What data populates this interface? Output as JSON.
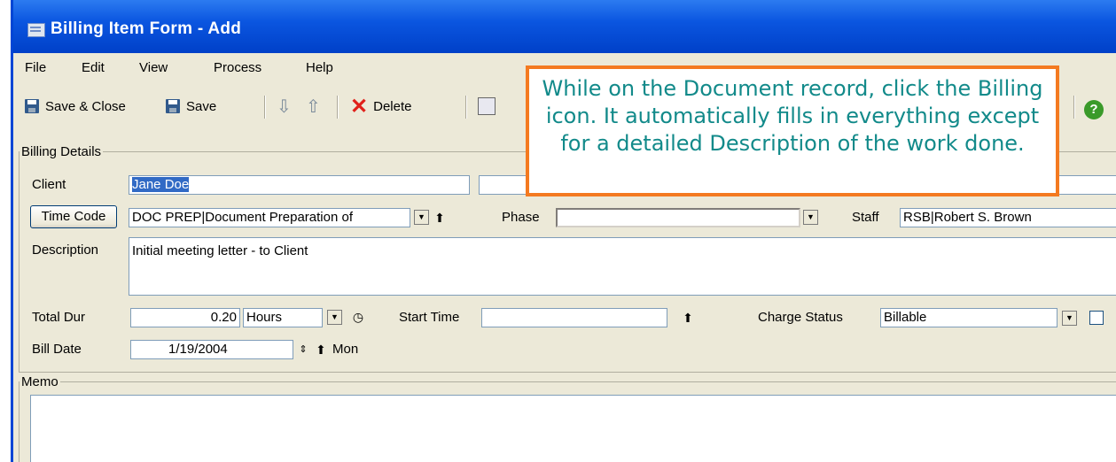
{
  "window": {
    "title": "Billing Item Form - Add"
  },
  "menu": [
    "File",
    "Edit",
    "View",
    "Process",
    "Help"
  ],
  "toolbar": {
    "save_close": "Save & Close",
    "save": "Save",
    "delete": "Delete",
    "help": "?"
  },
  "callout": {
    "text": "While on the Document record, click the Billing icon. It automatically fills in everything except for a detailed Description of the work done."
  },
  "billing": {
    "section_label": "Billing Details",
    "client_label": "Client",
    "client_value": "Jane Doe",
    "timecode_button": "Time Code",
    "timecode_value": "DOC PREP|Document Preparation of",
    "phase_label": "Phase",
    "phase_value": "",
    "staff_label": "Staff",
    "staff_value": "RSB|Robert S. Brown",
    "description_label": "Description",
    "description_value": "Initial meeting letter - to Client",
    "totaldur_label": "Total Dur",
    "totaldur_value": "0.20",
    "units_value": "Hours",
    "starttime_label": "Start Time",
    "starttime_value": "",
    "chargestatus_label": "Charge Status",
    "chargestatus_value": "Billable",
    "billdate_label": "Bill Date",
    "billdate_value": "1/19/2004",
    "billdate_day": "Mon"
  },
  "memo": {
    "label": "Memo",
    "value": ""
  }
}
